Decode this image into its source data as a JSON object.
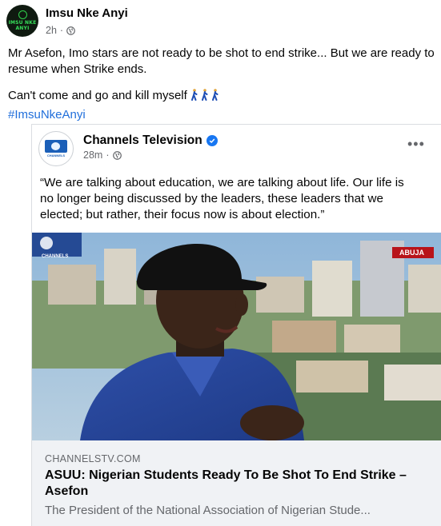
{
  "post": {
    "author": "Imsu Nke Anyi",
    "avatar_text_1": "IMSU NKE",
    "avatar_text_2": "ANYI",
    "time": "2h",
    "audience_icon": "globe-icon",
    "text_line_1": "Mr Asefon, Imo stars are not ready to be shot to end strike... But we are ready to resume when Strike ends.",
    "text_line_2": "Can't come and go and kill myself",
    "emoji": "person-walking-emoji",
    "hashtag": "#ImsuNkeAnyi"
  },
  "shared": {
    "page_name": "Channels Television",
    "logo_text": "CHANNELS",
    "verified_icon": "verified-badge-icon",
    "time": "28m",
    "audience_icon": "globe-icon",
    "more_label": "•••",
    "quote": "“We are talking about education, we are talking about life. Our life is no longer being discussed by the leaders, these leaders that we elected; but rather, their focus now is about election.”",
    "photo": {
      "channel_bug": "CHANNELS",
      "location_tag": "ABUJA"
    },
    "link": {
      "domain": "CHANNELSTV.COM",
      "title": "ASUU: Nigerian Students Ready To Be Shot To End Strike – Asefon",
      "description": "The President of the National Association of Nigerian Stude..."
    }
  },
  "colors": {
    "link_blue": "#216fdb",
    "verified_blue": "#1877f2",
    "meta_gray": "#65676b"
  }
}
